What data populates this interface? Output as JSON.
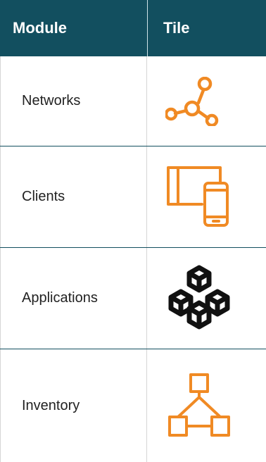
{
  "colors": {
    "header_bg": "#124f5f",
    "accent_orange": "#f08a24",
    "icon_black": "#111111",
    "divider": "#124f5f"
  },
  "table": {
    "headers": [
      "Module",
      "Tile"
    ],
    "rows": [
      {
        "module": "Networks",
        "tile_icon": "network-nodes-icon"
      },
      {
        "module": "Clients",
        "tile_icon": "devices-icon"
      },
      {
        "module": "Applications",
        "tile_icon": "cubes-icon"
      },
      {
        "module": "Inventory",
        "tile_icon": "hierarchy-icon"
      }
    ]
  }
}
